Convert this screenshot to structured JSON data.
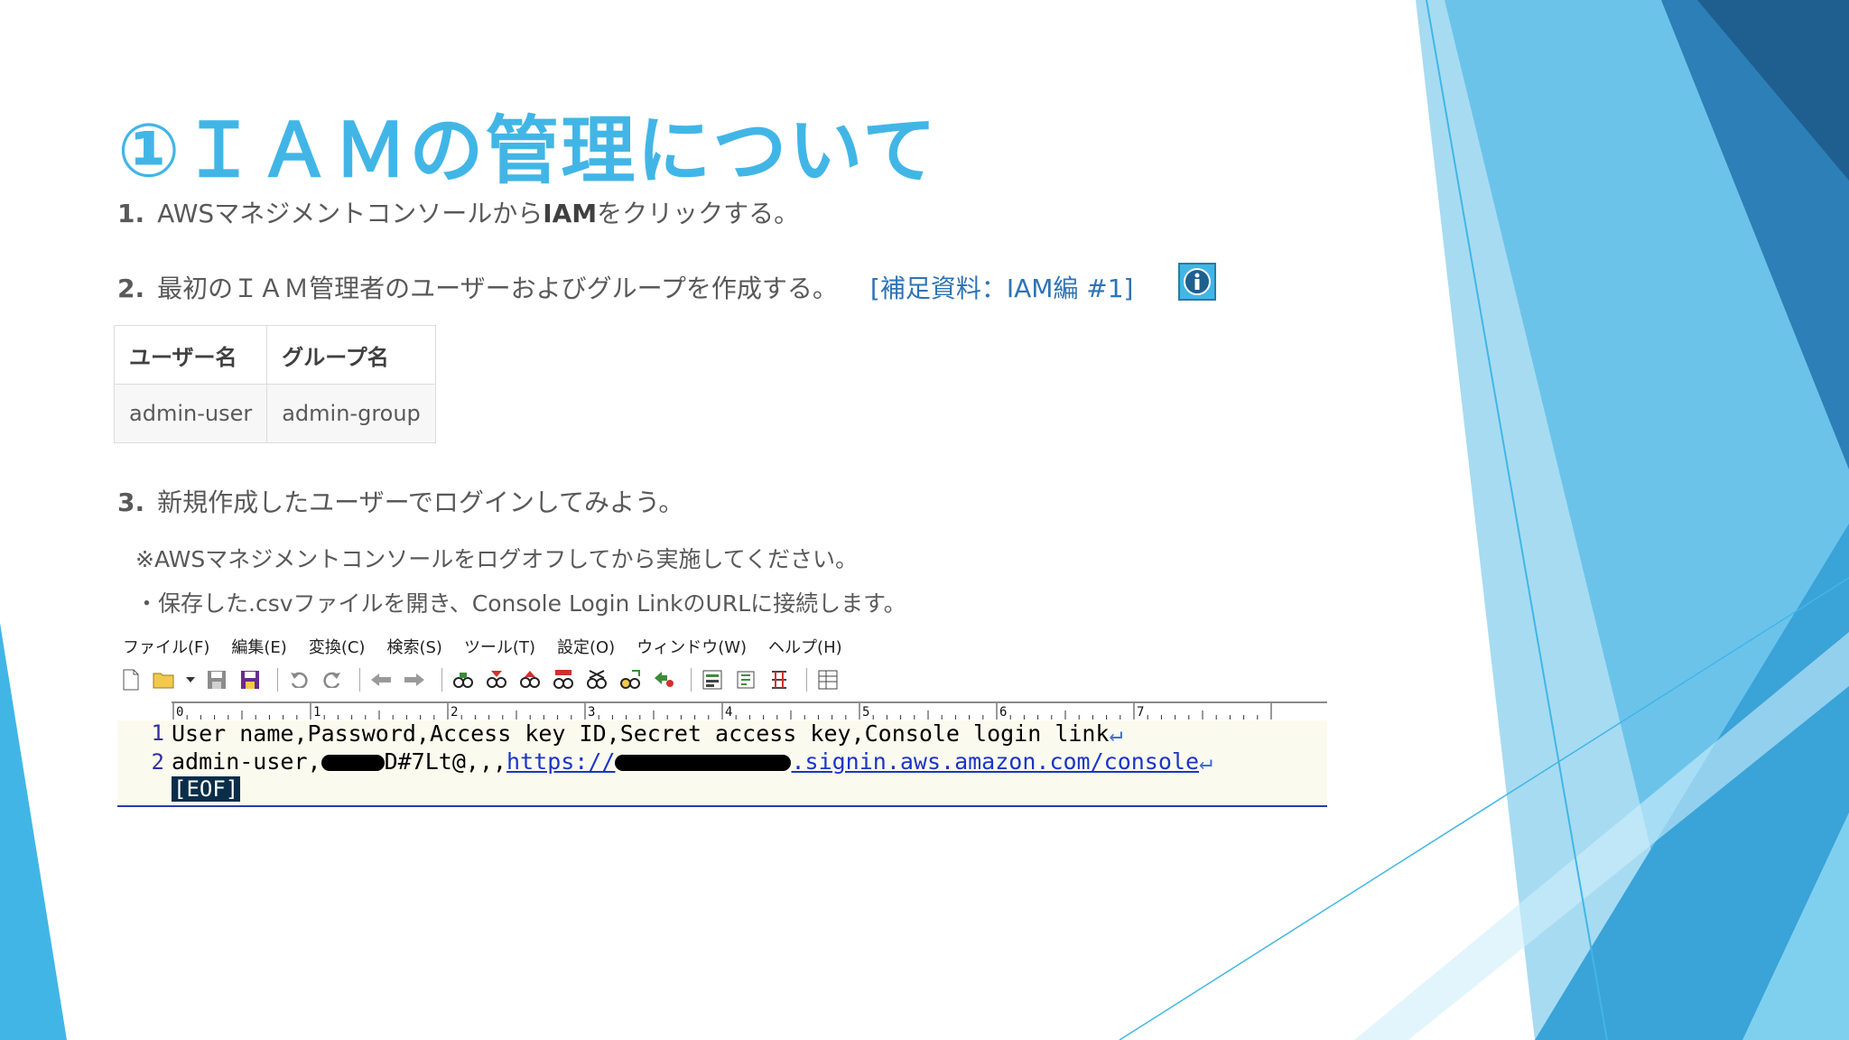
{
  "slide": {
    "title": "①ＩＡＭの管理について",
    "step1": {
      "num": "1.",
      "before": "AWSマネジメントコンソールから",
      "bold": "IAM",
      "after": "をクリックする。"
    },
    "step2": {
      "num": "2.",
      "text": "最初のＩＡＭ管理者のユーザーおよびグループを作成する。",
      "link": "[補足資料：IAM編 #1]"
    },
    "table": {
      "headers": [
        "ユーザー名",
        "グループ名"
      ],
      "rows": [
        [
          "admin-user",
          "admin-group"
        ]
      ]
    },
    "step3": {
      "num": "3.",
      "text": "新規作成したユーザーでログインしてみよう。"
    },
    "note1": "※AWSマネジメントコンソールをログオフしてから実施してください。",
    "note2": "・保存した.csvファイルを開き、Console Login LinkのURLに接続します。"
  },
  "editor": {
    "menus": [
      "ファイル(F)",
      "編集(E)",
      "変換(C)",
      "検索(S)",
      "ツール(T)",
      "設定(O)",
      "ウィンドウ(W)",
      "ヘルプ(H)"
    ],
    "ruler_marks": [
      "0",
      "1",
      "2",
      "3",
      "4",
      "5",
      "6",
      "7"
    ],
    "lines": [
      {
        "num": "1",
        "text": "User name,Password,Access key ID,Secret access key,Console login link"
      },
      {
        "num": "2",
        "prefix": "admin-user,",
        "partial": "D#7Lt@",
        "sep": ",,,",
        "url_start": "https://",
        "url_end": ".signin.aws.amazon.com/console"
      }
    ],
    "eof": "[EOF]",
    "newline_mark": "↵"
  },
  "icons": [
    "info-icon",
    "new-file-icon",
    "open-folder-icon",
    "save-icon",
    "save-all-icon",
    "undo-icon",
    "redo-icon",
    "back-icon",
    "forward-icon",
    "search-icon",
    "search-next-icon",
    "search-prev-icon",
    "replace-icon",
    "grep-icon",
    "tag-jump-icon",
    "outline-icon",
    "compare-icon",
    "settings-icon",
    "view-icon"
  ],
  "colors": {
    "title": "#41b6e6",
    "link": "#2e74b5",
    "accent_dark": "#1f5f8f",
    "url": "#1b35c9"
  }
}
